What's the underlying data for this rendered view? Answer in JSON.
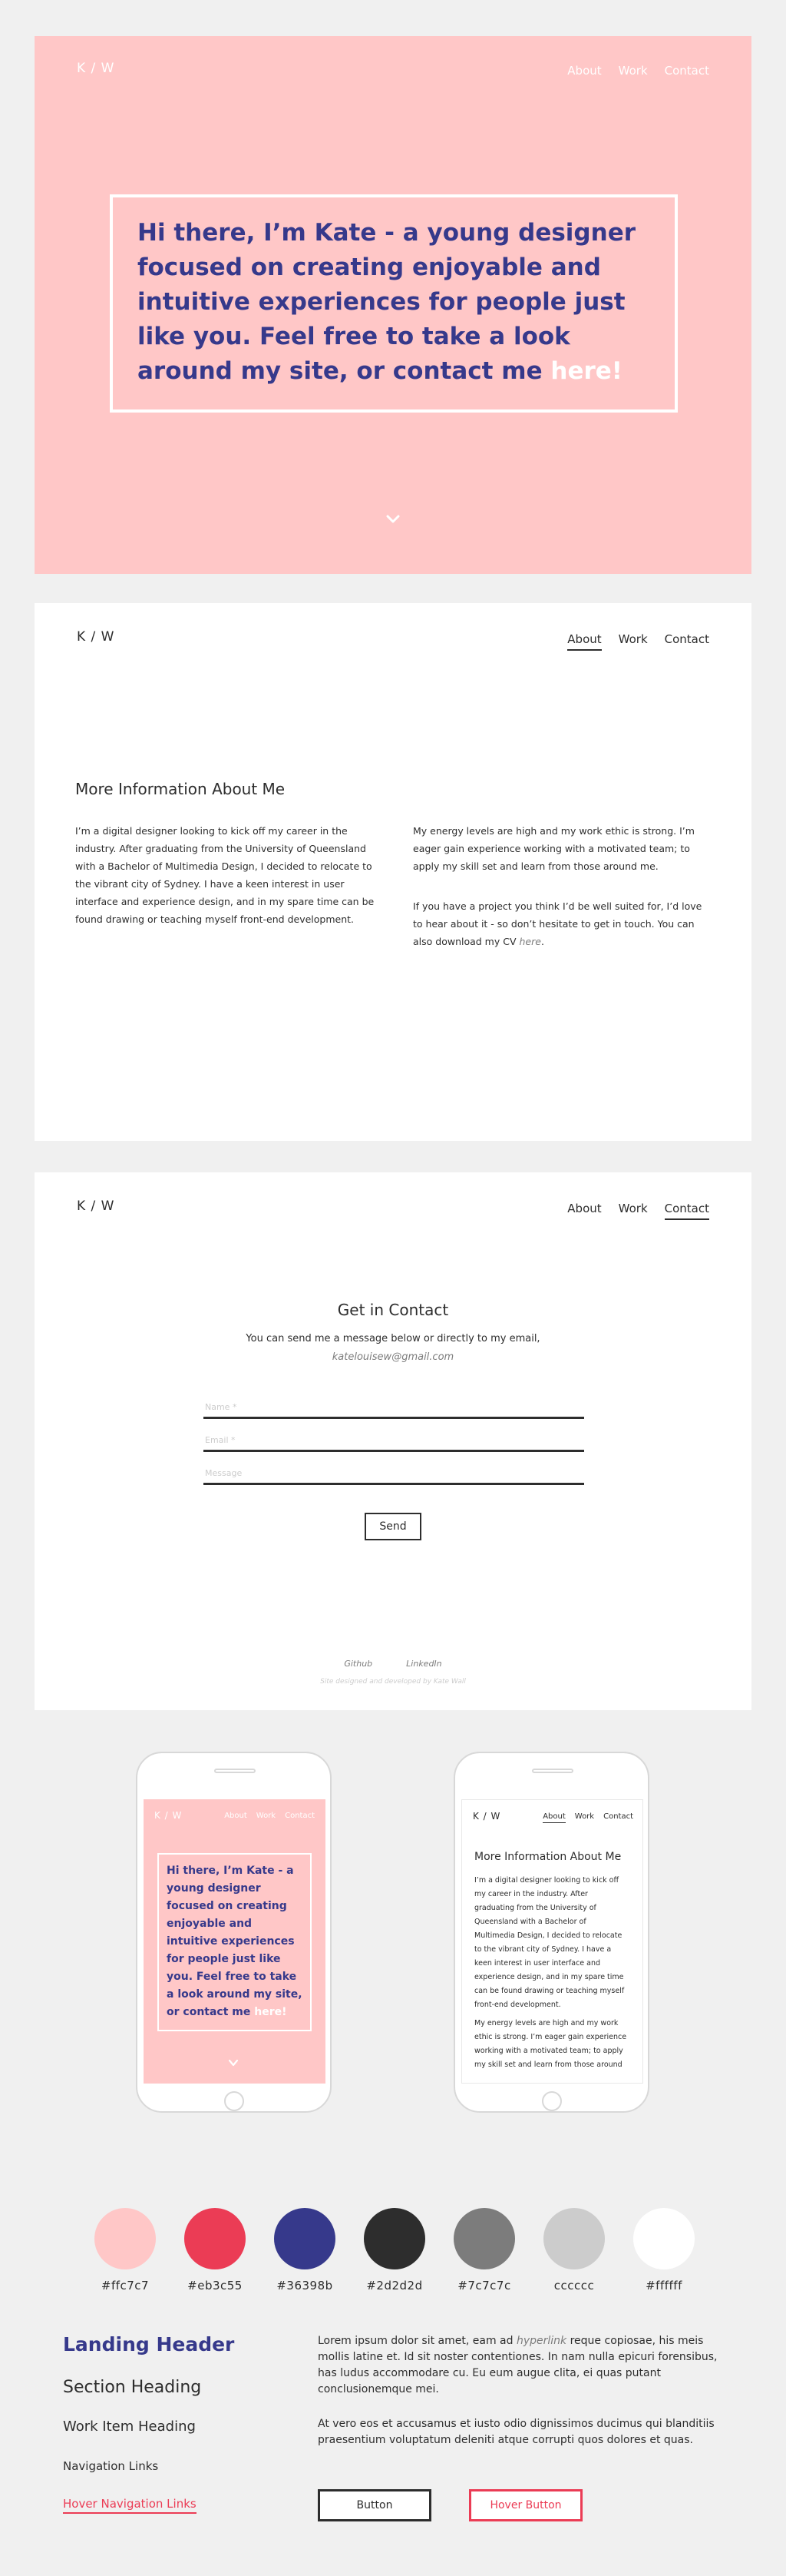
{
  "logo": "K / W",
  "nav": [
    "About",
    "Work",
    "Contact"
  ],
  "hero": {
    "text": "Hi there, I’m Kate - a young designer focused on creating enjoyable and intuitive experiences for people just like you. Feel free to take a look around my site, or contact me",
    "highlight": "here!"
  },
  "about": {
    "heading": "More Information About Me",
    "col1": "I’m a digital designer looking to kick off my career in the industry. After graduating from the University of Queensland with a Bachelor of Multimedia Design, I decided to relocate to the vibrant city of Sydney. I have a keen interest in user interface and experience design, and in my spare time can be found drawing or teaching myself front-end development.",
    "col2a": "My energy levels are high and my work ethic is strong. I’m eager gain experience working with a motivated team; to apply my skill set and learn from those around me.",
    "col2b": "If you have a project you think I’d be well suited for, I’d love to hear about it - so don’t hesitate to get in touch. You can also download my CV",
    "cv_link": "here",
    "cv_end": "."
  },
  "contact": {
    "heading": "Get in Contact",
    "subtitle": "You can send me a message below or directly to my email,",
    "email": "katelouisew@gmail.com",
    "fields": [
      "Name *",
      "Email *",
      "Message"
    ],
    "send": "Send",
    "footer_links": [
      "Github",
      "LinkedIn"
    ],
    "credit": "Site designed and developed by Kate Wall"
  },
  "mobile": {
    "hero_text": "Hi there, I’m Kate - a young designer focused on creating enjoyable and intuitive experiences for people just like you. Feel free to take a look around my site, or contact me",
    "hero_highlight": "here!",
    "about_heading": "More Information About Me",
    "about_p1": "I’m a digital designer looking to kick off my career in the industry. After graduating from the University of Queensland with a Bachelor of Multimedia Design, I decided to relocate to the vibrant city of Sydney. I have a keen interest in user interface and experience design, and in my spare time can be found drawing or teaching myself front-end development.",
    "about_p2": "My energy levels are high and my work ethic is strong. I’m eager gain experience working with a motivated team; to apply my skill set and learn from those around"
  },
  "palette": [
    {
      "hex": "#ffc7c7",
      "label": "#ffc7c7"
    },
    {
      "hex": "#eb3c55",
      "label": "#eb3c55"
    },
    {
      "hex": "#36398b",
      "label": "#36398b"
    },
    {
      "hex": "#2d2d2d",
      "label": "#2d2d2d"
    },
    {
      "hex": "#7c7c7c",
      "label": "#7c7c7c"
    },
    {
      "hex": "#cccccc",
      "label": "cccccc"
    },
    {
      "hex": "#ffffff",
      "label": "#ffffff"
    }
  ],
  "styleguide": {
    "landing": "Landing Header",
    "section": "Section Heading",
    "work": "Work Item Heading",
    "nav": "Navigation Links",
    "hover_nav": "Hover Navigation Links",
    "lorem1_a": "Lorem ipsum dolor sit amet, eam ad",
    "lorem1_link": "hyperlink",
    "lorem1_b": "reque copiosae, his meis mollis latine et. Id sit noster contentiones. In nam nulla epicuri forensibus, has ludus accommodare cu. Eu eum augue clita, ei quas putant conclusionemque mei.",
    "lorem2": "At vero eos et accusamus et iusto odio dignissimos ducimus qui blanditiis praesentium voluptatum deleniti atque corrupti quos dolores et quas.",
    "button": "Button",
    "hover_button": "Hover Button"
  }
}
